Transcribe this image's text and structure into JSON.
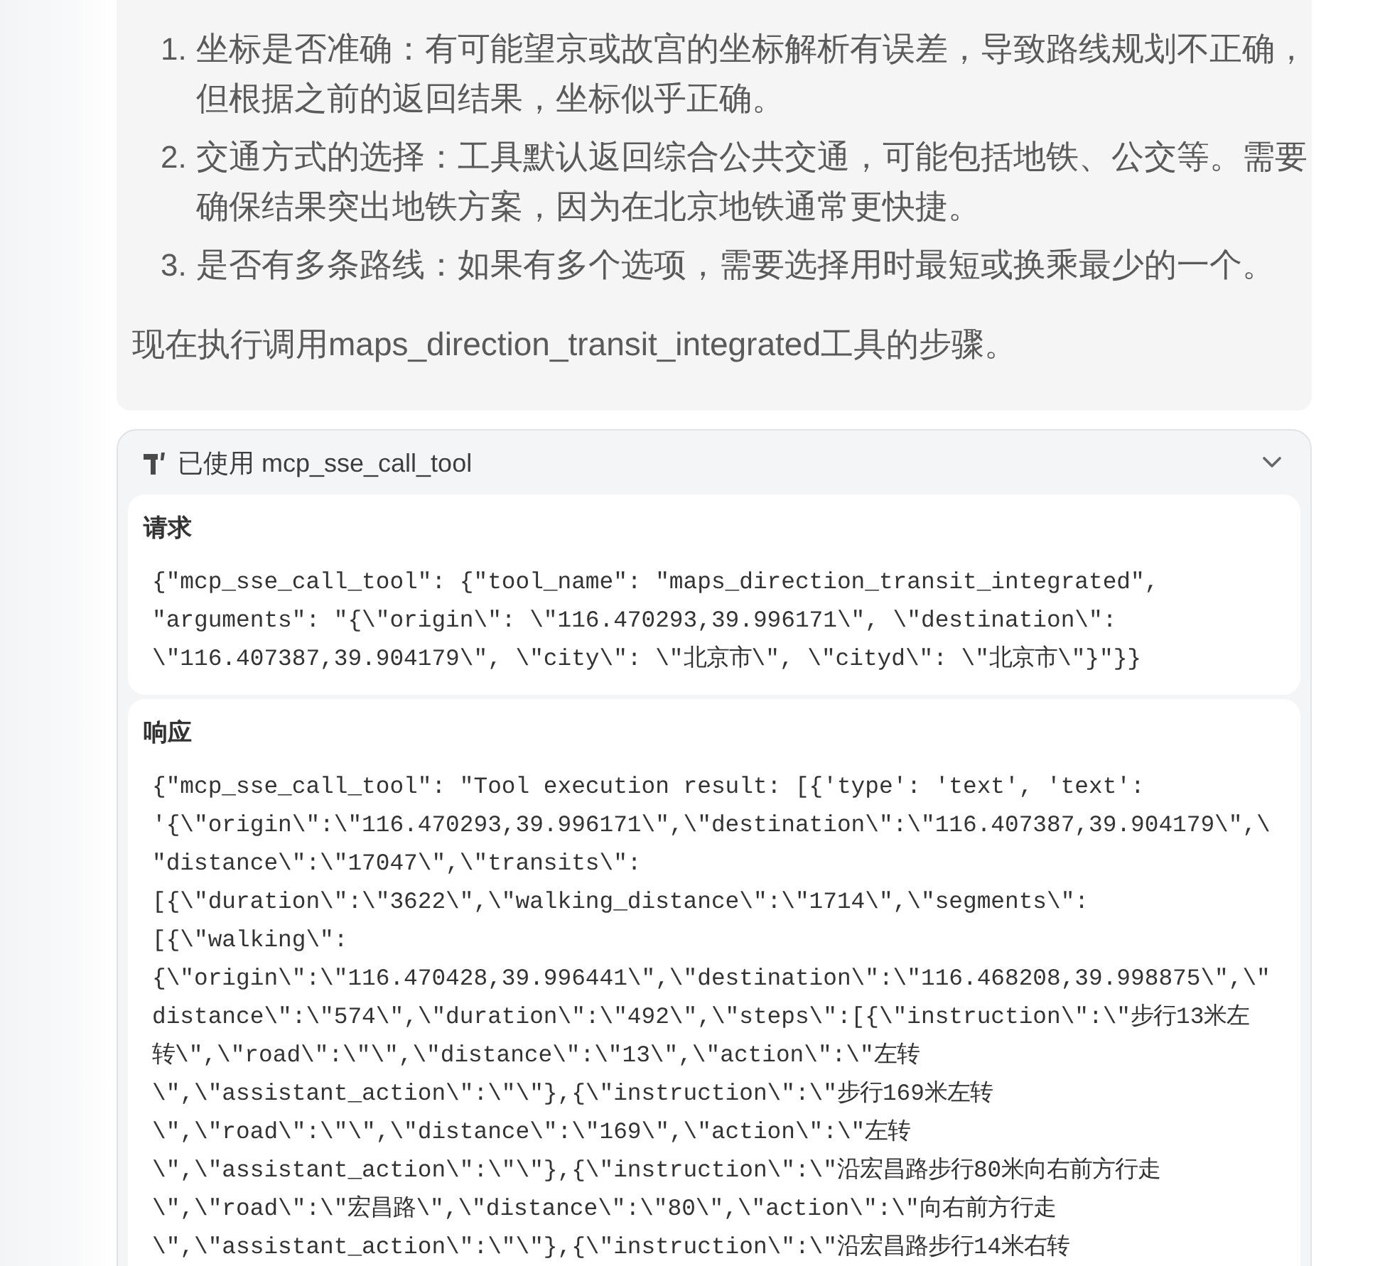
{
  "reasoning": {
    "list": [
      {
        "number": "1.",
        "text": "坐标是否准确：有可能望京或故宫的坐标解析有误差，导致路线规划不正确，但根据之前的返回结果，坐标似乎正确。"
      },
      {
        "number": "2.",
        "text": "交通方式的选择：工具默认返回综合公共交通，可能包括地铁、公交等。需要确保结果突出地铁方案，因为在北京地铁通常更快捷。"
      },
      {
        "number": "3.",
        "text": "是否有多条路线：如果有多个选项，需要选择用时最短或换乘最少的一个。"
      }
    ],
    "paragraph": "现在执行调用maps_direction_transit_integrated工具的步骤。"
  },
  "tool_card": {
    "title": "已使用 mcp_sse_call_tool",
    "expanded": true,
    "sections": [
      {
        "title": "请求",
        "lines": [
          "{\"mcp_sse_call_tool\": {\"tool_name\": \"maps_direction_transit_integrated\",",
          "\"arguments\": \"{\\\"origin\\\": \\\"116.470293,39.996171\\\", \\\"destination\\\":",
          "\\\"116.407387,39.904179\\\", \\\"city\\\": \\\"北京市\\\", \\\"cityd\\\": \\\"北京市\\\"}\"}}"
        ]
      },
      {
        "title": "响应",
        "lines": [
          "{\"mcp_sse_call_tool\": \"Tool execution result: [{'type': 'text', 'text':",
          "'{\\\"origin\\\":\\\"116.470293,39.996171\\\",\\\"destination\\\":\\\"116.407387,39.904179\\\",\\",
          "\"distance\\\":\\\"17047\\\",\\\"transits\\\":",
          "[{\\\"duration\\\":\\\"3622\\\",\\\"walking_distance\\\":\\\"1714\\\",\\\"segments\\\":",
          "[{\\\"walking\\\":",
          "{\\\"origin\\\":\\\"116.470428,39.996441\\\",\\\"destination\\\":\\\"116.468208,39.998875\\\",\\\"",
          "distance\\\":\\\"574\\\",\\\"duration\\\":\\\"492\\\",\\\"steps\\\":[{\\\"instruction\\\":\\\"步行13米左",
          "转\\\",\\\"road\\\":\\\"\\\",\\\"distance\\\":\\\"13\\\",\\\"action\\\":\\\"左转",
          "\\\",\\\"assistant_action\\\":\\\"\\\"},{\\\"instruction\\\":\\\"步行169米左转",
          "\\\",\\\"road\\\":\\\"\\\",\\\"distance\\\":\\\"169\\\",\\\"action\\\":\\\"左转",
          "\\\",\\\"assistant_action\\\":\\\"\\\"},{\\\"instruction\\\":\\\"沿宏昌路步行80米向右前方行走",
          "\\\",\\\"road\\\":\\\"宏昌路\\\",\\\"distance\\\":\\\"80\\\",\\\"action\\\":\\\"向右前方行走",
          "\\\",\\\"assistant_action\\\":\\\"\\\"},{\\\"instruction\\\":\\\"沿宏昌路步行14米右转"
        ]
      }
    ]
  }
}
